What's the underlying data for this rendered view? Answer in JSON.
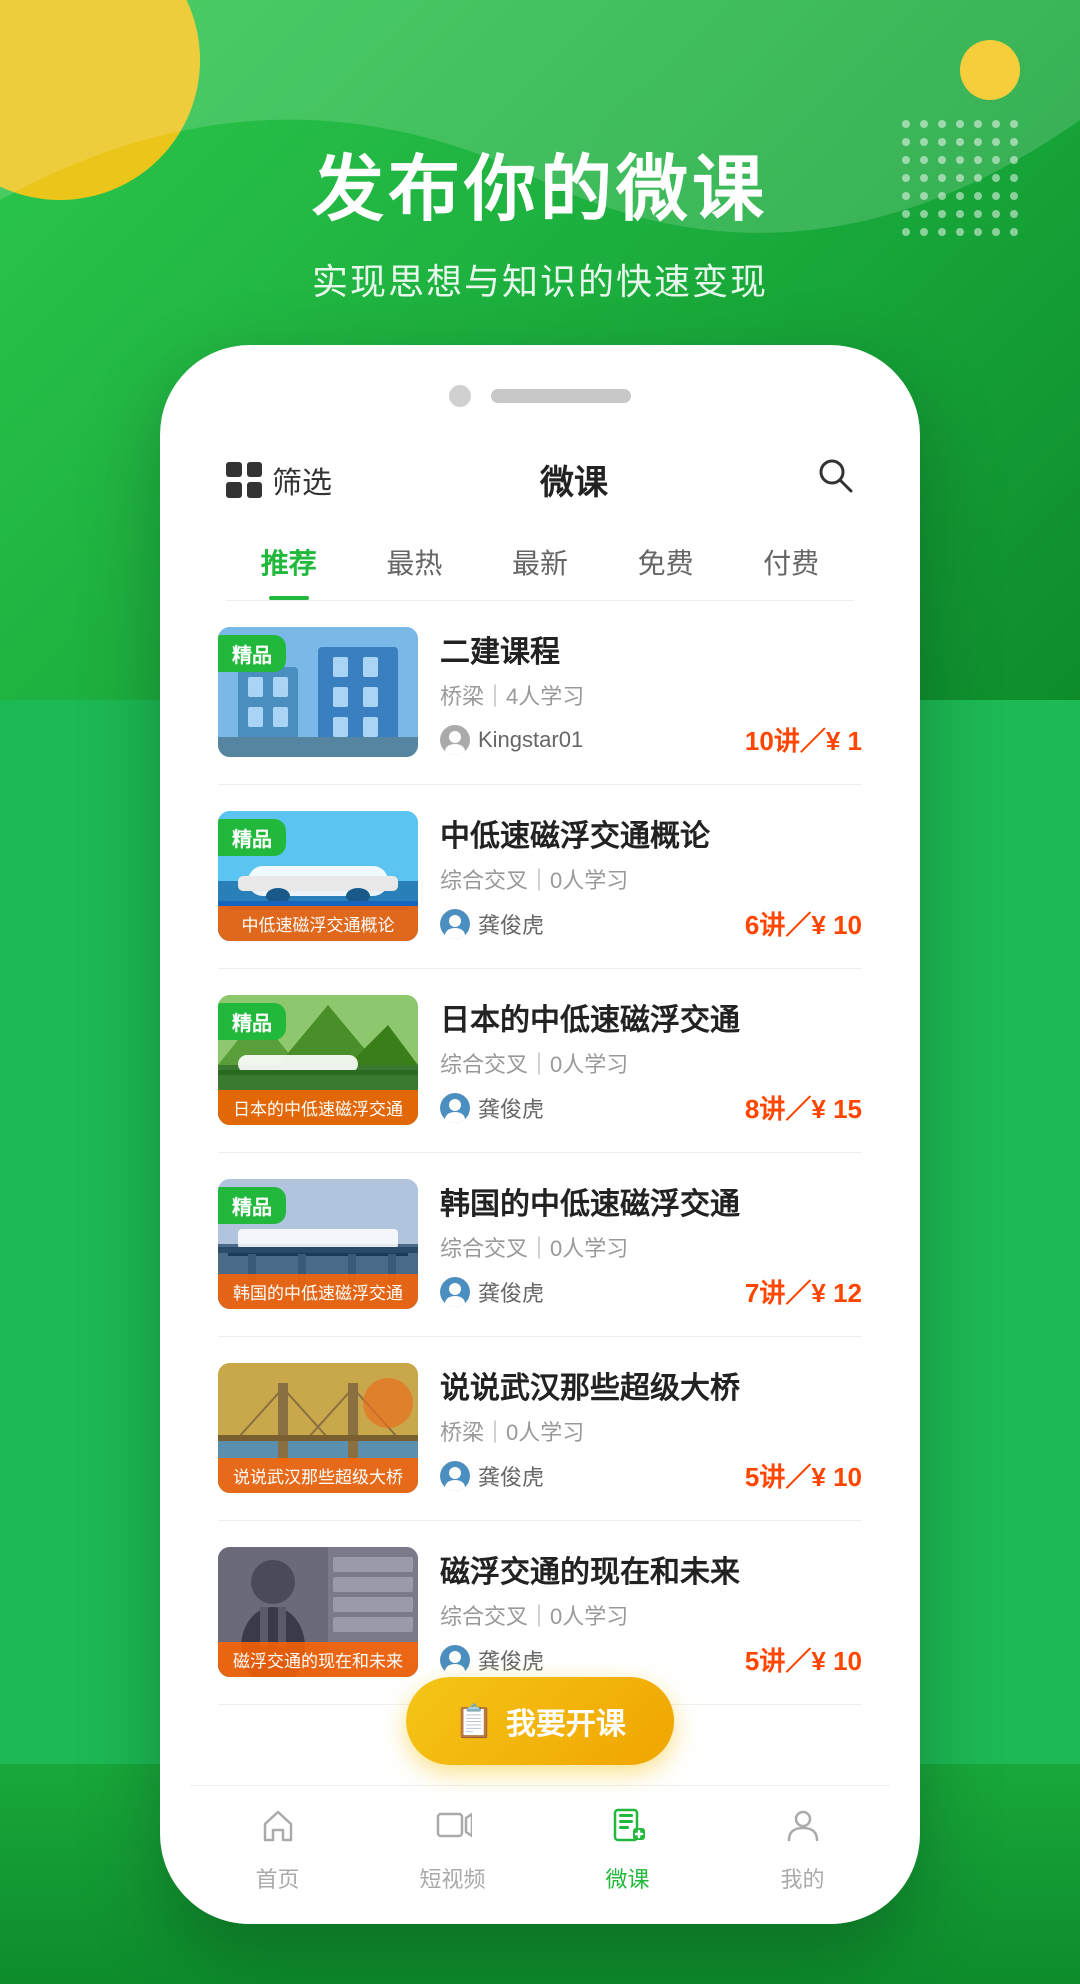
{
  "hero": {
    "title": "发布你的微课",
    "subtitle": "实现思想与知识的快速变现"
  },
  "header": {
    "filter_label": "筛选",
    "title": "微课",
    "search_aria": "搜索"
  },
  "tabs": [
    {
      "id": "recommended",
      "label": "推荐",
      "active": true
    },
    {
      "id": "hot",
      "label": "最热",
      "active": false
    },
    {
      "id": "latest",
      "label": "最新",
      "active": false
    },
    {
      "id": "free",
      "label": "免费",
      "active": false
    },
    {
      "id": "paid",
      "label": "付费",
      "active": false
    }
  ],
  "courses": [
    {
      "id": 1,
      "badge": "精品",
      "thumb_label": "",
      "title": "二建课程",
      "meta": "桥梁｜4人学习",
      "author": "Kingstar01",
      "price": "10讲／¥ 1",
      "thumb_class": "thumb-1"
    },
    {
      "id": 2,
      "badge": "精品",
      "thumb_label": "中低速磁浮交通概论",
      "title": "中低速磁浮交通概论",
      "meta": "综合交叉｜0人学习",
      "author": "龚俊虎",
      "price": "6讲／¥ 10",
      "thumb_class": "thumb-2"
    },
    {
      "id": 3,
      "badge": "精品",
      "thumb_label": "日本的中低速磁浮交通",
      "title": "日本的中低速磁浮交通",
      "meta": "综合交叉｜0人学习",
      "author": "龚俊虎",
      "price": "8讲／¥ 15",
      "thumb_class": "thumb-3"
    },
    {
      "id": 4,
      "badge": "精品",
      "thumb_label": "韩国的中低速磁浮交通",
      "title": "韩国的中低速磁浮交通",
      "meta": "综合交叉｜0人学习",
      "author": "龚俊虎",
      "price": "7讲／¥ 12",
      "thumb_class": "thumb-4"
    },
    {
      "id": 5,
      "badge": "",
      "thumb_label": "说说武汉那些超级大桥",
      "title": "说说武汉那些超级大桥",
      "meta": "桥梁｜0人学习",
      "author": "龚俊虎",
      "price": "5讲／¥ 10",
      "thumb_class": "thumb-5"
    },
    {
      "id": 6,
      "badge": "",
      "thumb_label": "磁浮交通的现在和未来",
      "title": "磁浮交通的现在和未来",
      "meta": "综合交叉｜0人学习",
      "author": "龚俊虎",
      "price": "5讲／¥ 10",
      "thumb_class": "thumb-6"
    }
  ],
  "fab": {
    "label": "我要开课",
    "icon": "📋"
  },
  "bottom_nav": [
    {
      "id": "home",
      "label": "首页",
      "icon": "⌂",
      "active": false
    },
    {
      "id": "video",
      "label": "短视频",
      "icon": "▶",
      "active": false
    },
    {
      "id": "micro",
      "label": "微课",
      "icon": "📗",
      "active": true
    },
    {
      "id": "profile",
      "label": "我的",
      "icon": "👤",
      "active": false
    }
  ],
  "colors": {
    "green": "#22b83c",
    "green_dark": "#0e8c2c",
    "yellow": "#f5c518",
    "red_price": "#ff4500",
    "bg": "#f5f5f5"
  }
}
